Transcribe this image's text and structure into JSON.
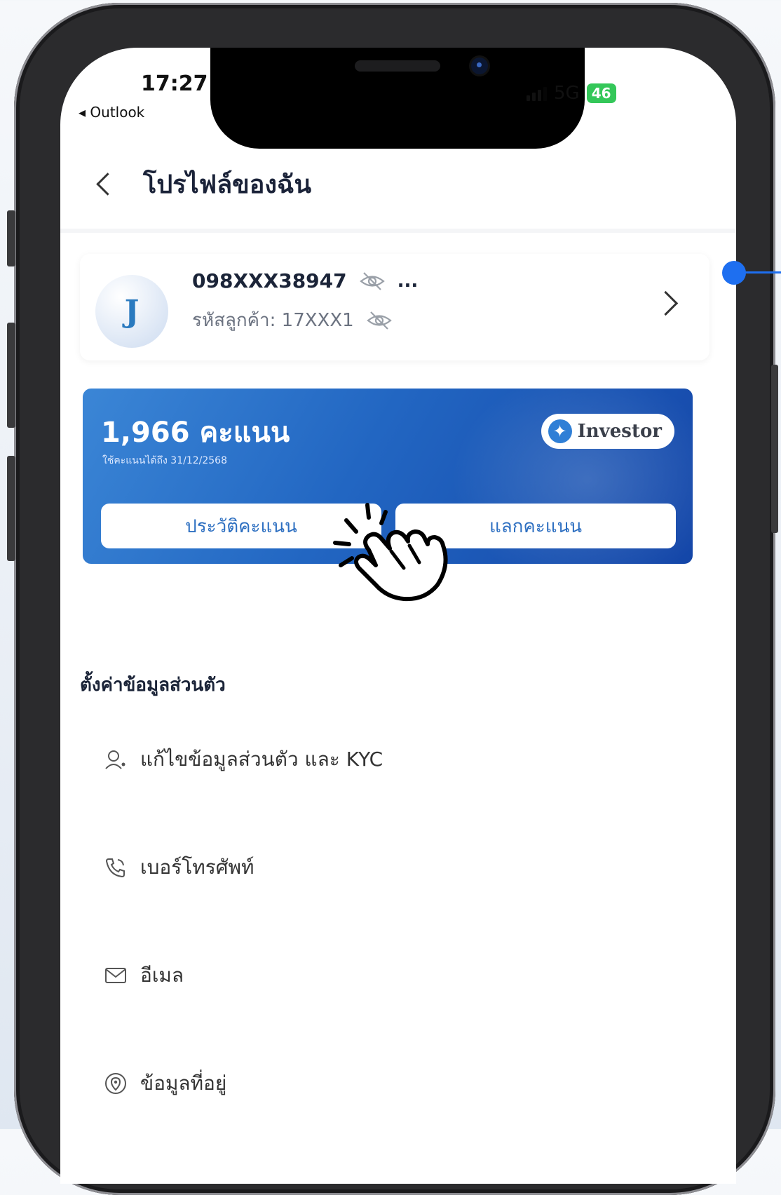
{
  "status_bar": {
    "time": "17:27",
    "back_app": "◂ Outlook",
    "network": "5G",
    "battery": "46"
  },
  "header": {
    "title": "โปรไฟล์ของฉัน"
  },
  "profile": {
    "avatar_initial": "J",
    "phone": "098XXX38947",
    "more": "...",
    "customer_code": "รหัสลูกค้า: 17XXX1"
  },
  "points": {
    "value": "1,966 คะแนน",
    "expiry": "ใช้คะแนนได้ถึง 31/12/2568",
    "tier": "Investor",
    "history_label": "ประวัติคะแนน",
    "redeem_label": "แลกคะแนน"
  },
  "settings": {
    "title": "ตั้งค่าข้อมูลส่วนตัว",
    "items": [
      {
        "label": "แก้ไขข้อมูลส่วนตัว และ KYC",
        "icon": "user-edit-icon"
      },
      {
        "label": "เบอร์โทรศัพท์",
        "icon": "phone-icon"
      },
      {
        "label": "อีเมล",
        "icon": "mail-icon"
      },
      {
        "label": "ข้อมูลที่อยู่",
        "icon": "location-icon"
      }
    ]
  },
  "colors": {
    "accent": "#2d6fc1",
    "card_gradient_start": "#3b86d6",
    "card_gradient_end": "#1446a8",
    "battery": "#34c759",
    "annotation": "#1e6ff0"
  }
}
